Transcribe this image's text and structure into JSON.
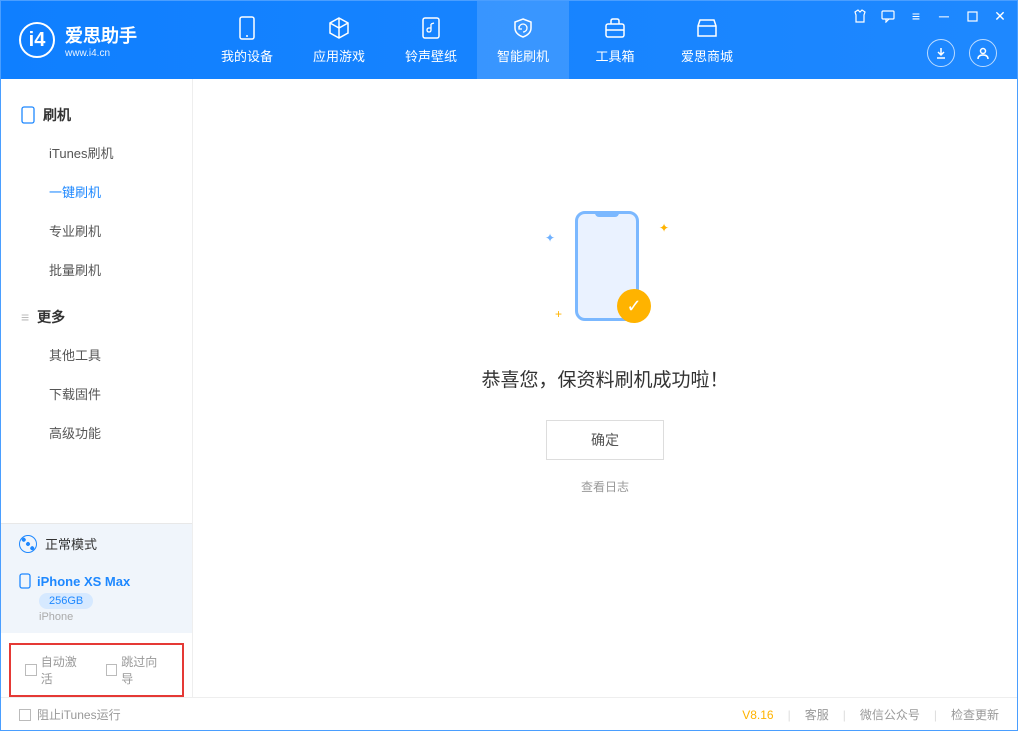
{
  "app": {
    "name": "爱思助手",
    "url": "www.i4.cn"
  },
  "nav": [
    {
      "label": "我的设备"
    },
    {
      "label": "应用游戏"
    },
    {
      "label": "铃声壁纸"
    },
    {
      "label": "智能刷机"
    },
    {
      "label": "工具箱"
    },
    {
      "label": "爱思商城"
    }
  ],
  "sidebar": {
    "section1": {
      "title": "刷机",
      "items": [
        "iTunes刷机",
        "一键刷机",
        "专业刷机",
        "批量刷机"
      ]
    },
    "section2": {
      "title": "更多",
      "items": [
        "其他工具",
        "下载固件",
        "高级功能"
      ]
    }
  },
  "device": {
    "mode": "正常模式",
    "name": "iPhone XS Max",
    "storage": "256GB",
    "type": "iPhone"
  },
  "checkboxes": {
    "auto_activate": "自动激活",
    "skip_guide": "跳过向导"
  },
  "main": {
    "success_msg": "恭喜您，保资料刷机成功啦！",
    "ok": "确定",
    "view_log": "查看日志"
  },
  "footer": {
    "block_itunes": "阻止iTunes运行",
    "version": "V8.16",
    "links": [
      "客服",
      "微信公众号",
      "检查更新"
    ]
  }
}
